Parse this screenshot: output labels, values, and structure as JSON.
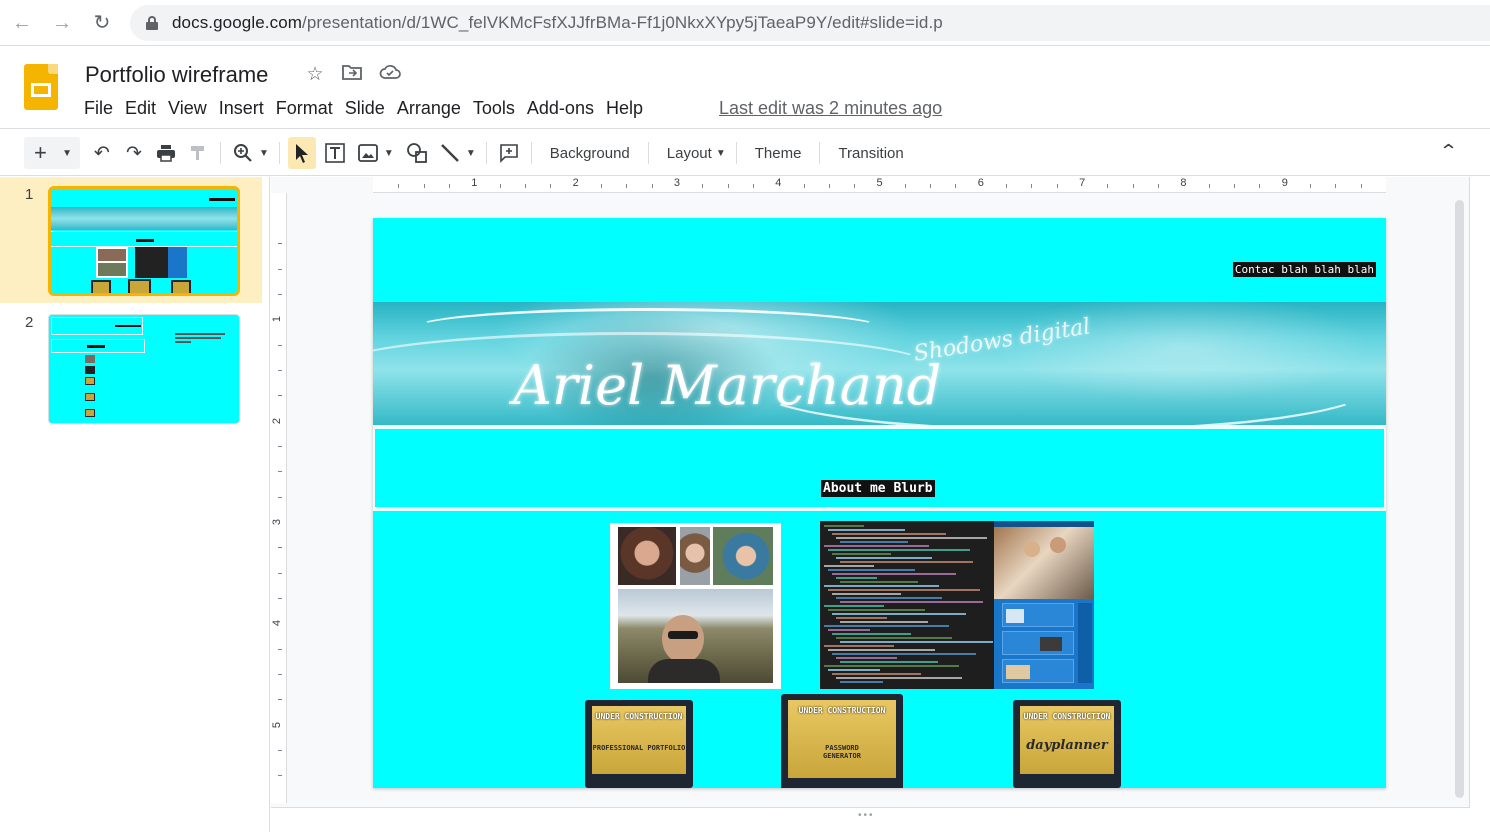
{
  "browser": {
    "url_domain": "docs.google.com",
    "url_path": "/presentation/d/1WC_felVKMcFsfXJJfrBMa-Ff1j0NkxXYpy5jTaeaP9Y/edit#slide=id.p",
    "back_icon": "arrow-left-icon",
    "forward_icon": "arrow-right-icon",
    "reload_icon": "reload-icon"
  },
  "app": {
    "title": "Portfolio wireframe",
    "menu": [
      "File",
      "Edit",
      "View",
      "Insert",
      "Format",
      "Slide",
      "Arrange",
      "Tools",
      "Add-ons",
      "Help"
    ],
    "last_edit": "Last edit was 2 minutes ago"
  },
  "toolbar": {
    "background_label": "Background",
    "layout_label": "Layout",
    "theme_label": "Theme",
    "transition_label": "Transition"
  },
  "filmstrip": {
    "slides": [
      {
        "number": "1",
        "selected": true
      },
      {
        "number": "2",
        "selected": false
      }
    ]
  },
  "rulers": {
    "horizontal": [
      "1",
      "2",
      "3",
      "4",
      "5",
      "6",
      "7",
      "8",
      "9"
    ],
    "vertical": [
      "1",
      "2",
      "3",
      "4",
      "5"
    ]
  },
  "slide": {
    "contact_text": "Contac blah blah blah",
    "about_text": "About me Blurb",
    "banner_name": "Ariel Marchand",
    "banner_tagline": "Shodows digital"
  },
  "colors": {
    "slide_bg": "#00ffff",
    "selected_thumb_border": "#f4b400",
    "selected_row_bg": "#feefc3"
  }
}
